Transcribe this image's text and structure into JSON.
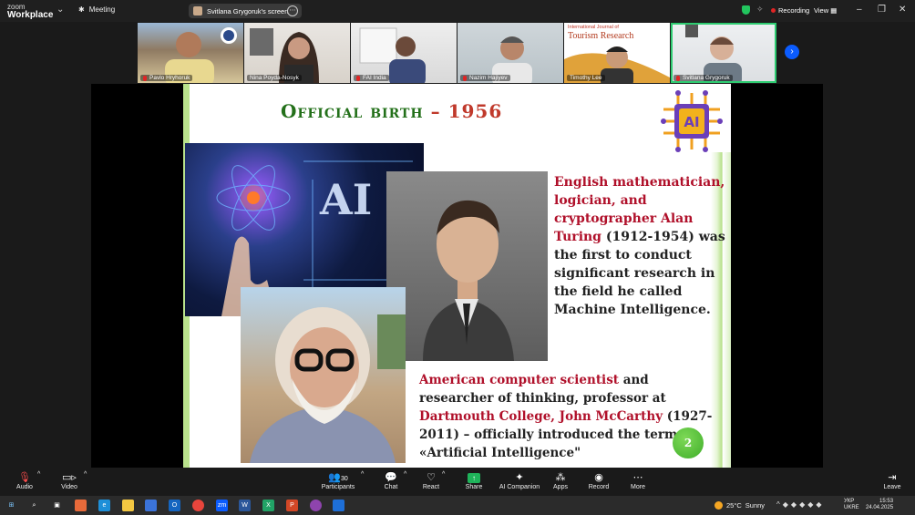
{
  "app": {
    "logo_line1": "zoom",
    "logo_line2": "Workplace",
    "meeting_label": "Meeting"
  },
  "share_pill": {
    "label": "Svitlana Grygoruk's screen"
  },
  "status": {
    "recording_label": "Recording",
    "view_label": "View"
  },
  "participants_strip": [
    {
      "name": "Pavlo Hryhoruk"
    },
    {
      "name": "Nina Poyda-Nosyk"
    },
    {
      "name": "FAI India"
    },
    {
      "name": "Nazim Hajiyev"
    },
    {
      "name": "Timothy Lee",
      "banner_line1": "International Journal of",
      "banner_line2": "Tourism Research"
    },
    {
      "name": "Svitlana Grygoruk",
      "active": true
    }
  ],
  "slide": {
    "title_main": "Official birth",
    "title_year": "– 1956",
    "chip_label": "AI",
    "image_ai_text": "AI",
    "text1_red1": "English mathematician, logician, and cryptographer Alan Turing",
    "text1_black": " (1912-1954) was the first to conduct significant research in the field he called Machine Intelligence.",
    "text2_red": "American computer scientist",
    "text2_black1": " and researcher of thinking, professor at ",
    "text2_red2": "Dartmouth College, John McCarthy",
    "text2_black2": " (1927-2011) – officially introduced the term «Artificial Intelligence\"",
    "page_number": "2"
  },
  "toolbar": {
    "audio": "Audio",
    "video": "Video",
    "participants_count": "30",
    "participants": "Participants",
    "chat": "Chat",
    "react": "React",
    "share": "Share",
    "ai_companion": "AI Companion",
    "apps": "Apps",
    "record": "Record",
    "more": "More",
    "leave": "Leave"
  },
  "taskbar": {
    "temperature": "25°C",
    "weather": "Sunny",
    "lang1": "УКР",
    "lang2": "UKRE",
    "time": "15:53",
    "date": "24.04.2025"
  },
  "colors": {
    "accent_green": "#2ecc71",
    "zoom_blue": "#0b5cff",
    "slide_title_green": "#23701a",
    "slide_red": "#b0102a"
  }
}
